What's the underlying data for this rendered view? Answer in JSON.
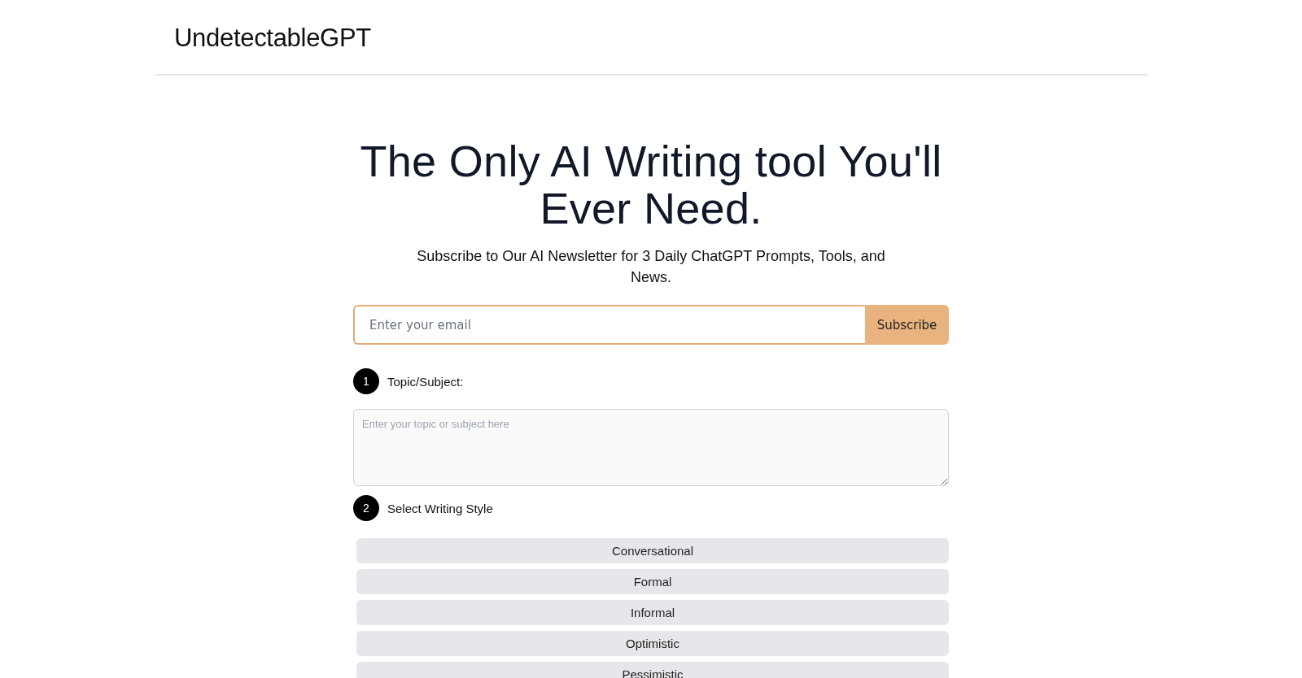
{
  "header": {
    "logo": "UndetectableGPT"
  },
  "hero": {
    "title": "The Only AI Writing tool You'll Ever Need.",
    "subtitle": "Subscribe to Our AI Newsletter for 3 Daily ChatGPT Prompts, Tools, and News."
  },
  "newsletter": {
    "email_field": {
      "placeholder": "Enter your email"
    },
    "subscribe_button": "Subscribe"
  },
  "steps": [
    {
      "number": "1",
      "label": "Topic/Subject:",
      "kind": "textarea",
      "placeholder": "Enter your topic or subject here"
    },
    {
      "number": "2",
      "label": "Select Writing Style",
      "kind": "options",
      "options": [
        {
          "label": "Conversational",
          "selected": false
        },
        {
          "label": "Formal",
          "selected": false
        },
        {
          "label": "Informal",
          "selected": false
        },
        {
          "label": "Optimistic",
          "selected": false
        },
        {
          "label": "Pessimistic",
          "selected": false
        }
      ]
    }
  ]
}
